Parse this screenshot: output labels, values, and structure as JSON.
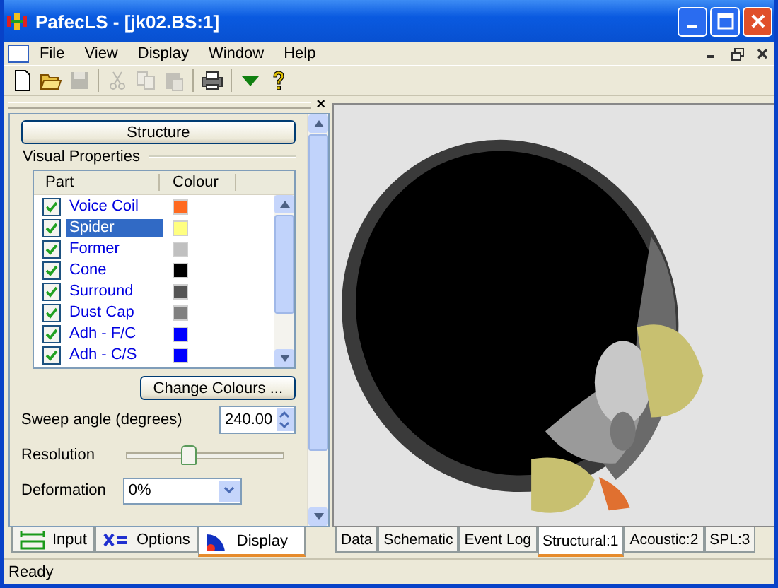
{
  "window": {
    "title": "PafecLS - [jk02.BS:1]"
  },
  "menu": [
    "File",
    "View",
    "Display",
    "Window",
    "Help"
  ],
  "toolbar": [
    {
      "kind": "new",
      "disabled": false
    },
    {
      "kind": "open",
      "disabled": false
    },
    {
      "kind": "save",
      "disabled": true
    },
    {
      "kind": "cut",
      "disabled": true
    },
    {
      "kind": "copy",
      "disabled": true
    },
    {
      "kind": "paste",
      "disabled": true
    },
    {
      "kind": "print",
      "disabled": false
    },
    {
      "kind": "down",
      "disabled": false
    },
    {
      "kind": "help",
      "disabled": false
    }
  ],
  "panel": {
    "close": "×",
    "section_button": "Structure",
    "group_title": "Visual Properties",
    "columns": [
      "Part",
      "Colour"
    ],
    "parts": [
      {
        "name": "Voice Coil",
        "checked": true,
        "selected": false,
        "color": "#ff6a20"
      },
      {
        "name": "Spider",
        "checked": true,
        "selected": true,
        "color": "#ffff80"
      },
      {
        "name": "Former",
        "checked": true,
        "selected": false,
        "color": "#c0c0c0"
      },
      {
        "name": "Cone",
        "checked": true,
        "selected": false,
        "color": "#000000"
      },
      {
        "name": "Surround",
        "checked": true,
        "selected": false,
        "color": "#555555"
      },
      {
        "name": "Dust Cap",
        "checked": true,
        "selected": false,
        "color": "#808080"
      },
      {
        "name": "Adh - F/C",
        "checked": true,
        "selected": false,
        "color": "#0000ff"
      },
      {
        "name": "Adh - C/S",
        "checked": true,
        "selected": false,
        "color": "#0000ff"
      }
    ],
    "change_button": "Change Colours ...",
    "sweep_label": "Sweep angle (degrees)",
    "sweep_value": "240.00",
    "resolution_label": "Resolution",
    "resolution": {
      "level": 0.38
    },
    "deformation_label": "Deformation",
    "deformation_value": "0%"
  },
  "panel_tabs": [
    {
      "label": "Input",
      "selected": false
    },
    {
      "label": "Options",
      "selected": false
    },
    {
      "label": "Display",
      "selected": true
    }
  ],
  "view_tabs": [
    {
      "label": "Data",
      "selected": false
    },
    {
      "label": "Schematic",
      "selected": false
    },
    {
      "label": "Event Log",
      "selected": false
    },
    {
      "label": "Structural:1",
      "selected": true
    },
    {
      "label": "Acoustic:2",
      "selected": false
    },
    {
      "label": "SPL:3",
      "selected": false
    }
  ],
  "status_bar": "Ready"
}
